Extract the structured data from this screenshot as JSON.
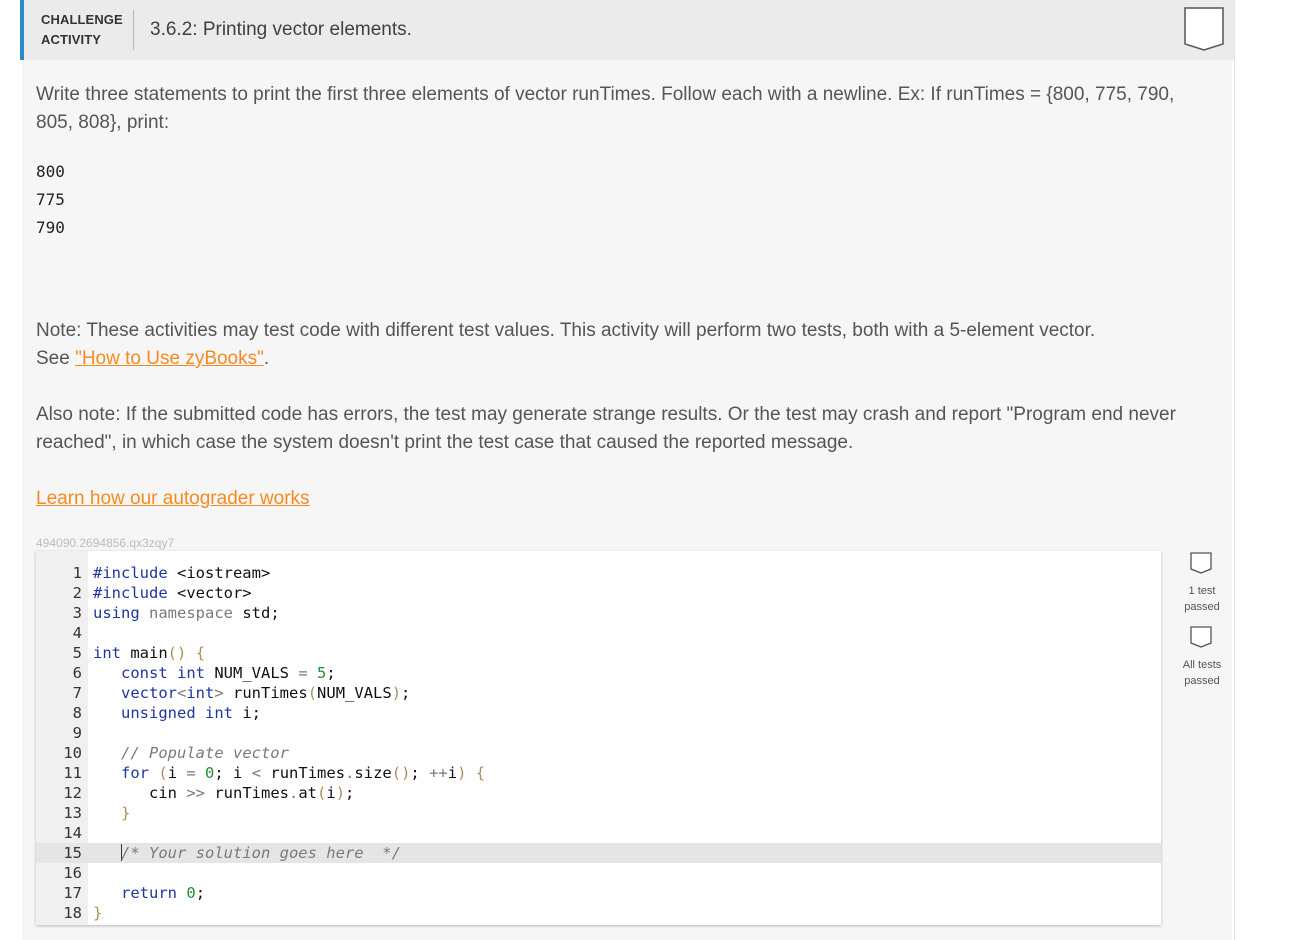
{
  "header": {
    "label_line1": "CHALLENGE",
    "label_line2": "ACTIVITY",
    "title": "3.6.2: Printing vector elements."
  },
  "instructions": {
    "p1": "Write three statements to print the first three elements of vector runTimes. Follow each with a newline. Ex: If runTimes = {800, 775, 790, 805, 808}, print:",
    "sample_output": [
      "800",
      "775",
      "790"
    ],
    "note": "Note: These activities may test code with different test values. This activity will perform two tests, both with a 5-element vector.",
    "note_see": "See ",
    "note_link": "\"How to Use zyBooks\"",
    "note_end": ".",
    "also_note": "Also note: If the submitted code has errors, the test may generate strange results. Or the test may crash and report \"Program end never reached\", in which case the system doesn't print the test case that caused the reported message.",
    "autograder_link": "Learn how our autograder works"
  },
  "activity_id": "494090.2694856.qx3zqy7",
  "code_lines": [
    "#include <iostream>",
    "#include <vector>",
    "using namespace std;",
    "",
    "int main() {",
    "   const int NUM_VALS = 5;",
    "   vector<int> runTimes(NUM_VALS);",
    "   unsigned int i;",
    "",
    "   // Populate vector",
    "   for (i = 0; i < runTimes.size(); ++i) {",
    "      cin >> runTimes.at(i);",
    "   }",
    "",
    "   /* Your solution goes here  */",
    "",
    "   return 0;",
    "}"
  ],
  "active_line": 15,
  "tests": [
    {
      "label_line1": "1 test",
      "label_line2": "passed",
      "passed": false
    },
    {
      "label_line1": "All tests",
      "label_line2": "passed",
      "passed": false
    }
  ],
  "colors": {
    "accent_blue": "#2b8bc6",
    "link_orange": "#f68a1e",
    "keyword_blue": "#1f35a0",
    "number_green": "#1a8f3a"
  }
}
